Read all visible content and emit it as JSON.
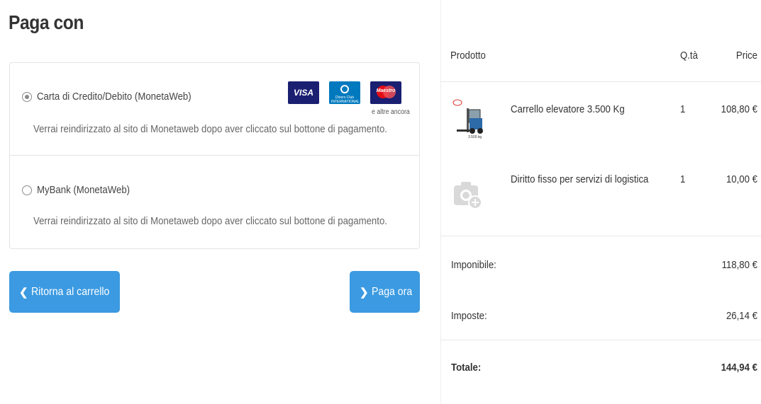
{
  "left": {
    "title": "Paga con",
    "options": [
      {
        "label": "Carta di Credito/Debito (MonetaWeb)",
        "description": "Verrai reindirizzato al sito di Monetaweb dopo aver cliccato sul bottone di pagamento.",
        "selected": true,
        "logos": {
          "visa": "VISA",
          "diners": "Diners Club INTERNATIONAL",
          "maestro": "Maestro",
          "more": "e altre ancora"
        }
      },
      {
        "label": "MyBank (MonetaWeb)",
        "description": "Verrai reindirizzato al sito di Monetaweb dopo aver cliccato sul bottone di pagamento.",
        "selected": false
      }
    ],
    "back_button": "Ritorna al carrello",
    "pay_button": "Paga ora"
  },
  "summary": {
    "headers": {
      "product": "Prodotto",
      "qty": "Q.tà",
      "price": "Price"
    },
    "items": [
      {
        "name": "Carrello elevatore 3.500 Kg",
        "qty": "1",
        "price": "108,80 €",
        "thumb": "forklift-image",
        "thumb_caption": "3.500 kg"
      },
      {
        "name": "Diritto fisso per servizi di logistica",
        "qty": "1",
        "price": "10,00 €",
        "thumb": "camera-placeholder-icon"
      }
    ],
    "imponibile_label": "Imponibile:",
    "imponibile_value": "118,80 €",
    "imposte_label": "Imposte:",
    "imposte_value": "26,14 €",
    "totale_label": "Totale:",
    "totale_value": "144,94 €"
  },
  "colors": {
    "button": "#3b9ae1",
    "border": "#e4e4e4"
  }
}
